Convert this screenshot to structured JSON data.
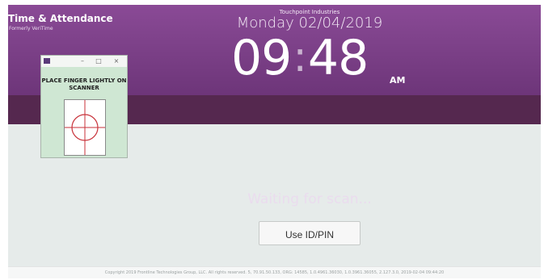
{
  "brand": {
    "title": "Time & Attendance",
    "subtitle": "Formerly VeriTime"
  },
  "header": {
    "company": "Touchpoint Industries",
    "date": "Monday 02/04/2019",
    "clock": {
      "hours": "09",
      "separator": ":",
      "minutes": "48",
      "ampm": "AM"
    }
  },
  "status": {
    "message": "Waiting for scan..."
  },
  "scanner_popup": {
    "instruction": "PLACE FINGER LIGHTLY ON SCANNER",
    "minimize_icon": "minimize-icon",
    "maximize_icon": "maximize-icon",
    "close_icon": "close-icon"
  },
  "actions": {
    "use_pin_label": "Use ID/PIN"
  },
  "footer": {
    "copyright": "Copyright 2019 Frontline Technologies Group, LLC. All rights reserved. 5, 70.91.50.133, ORG: 14585, 1.0.4961.36030, 1.0.3961.36055, 2.127.3.0, 2019-02-04 09:44:20"
  },
  "colors": {
    "header_purple": "#7a3f86",
    "status_bar": "#55284f",
    "body_bg": "#e6ebea",
    "popup_green": "#cfe7d3",
    "target_red": "#c8323a"
  }
}
